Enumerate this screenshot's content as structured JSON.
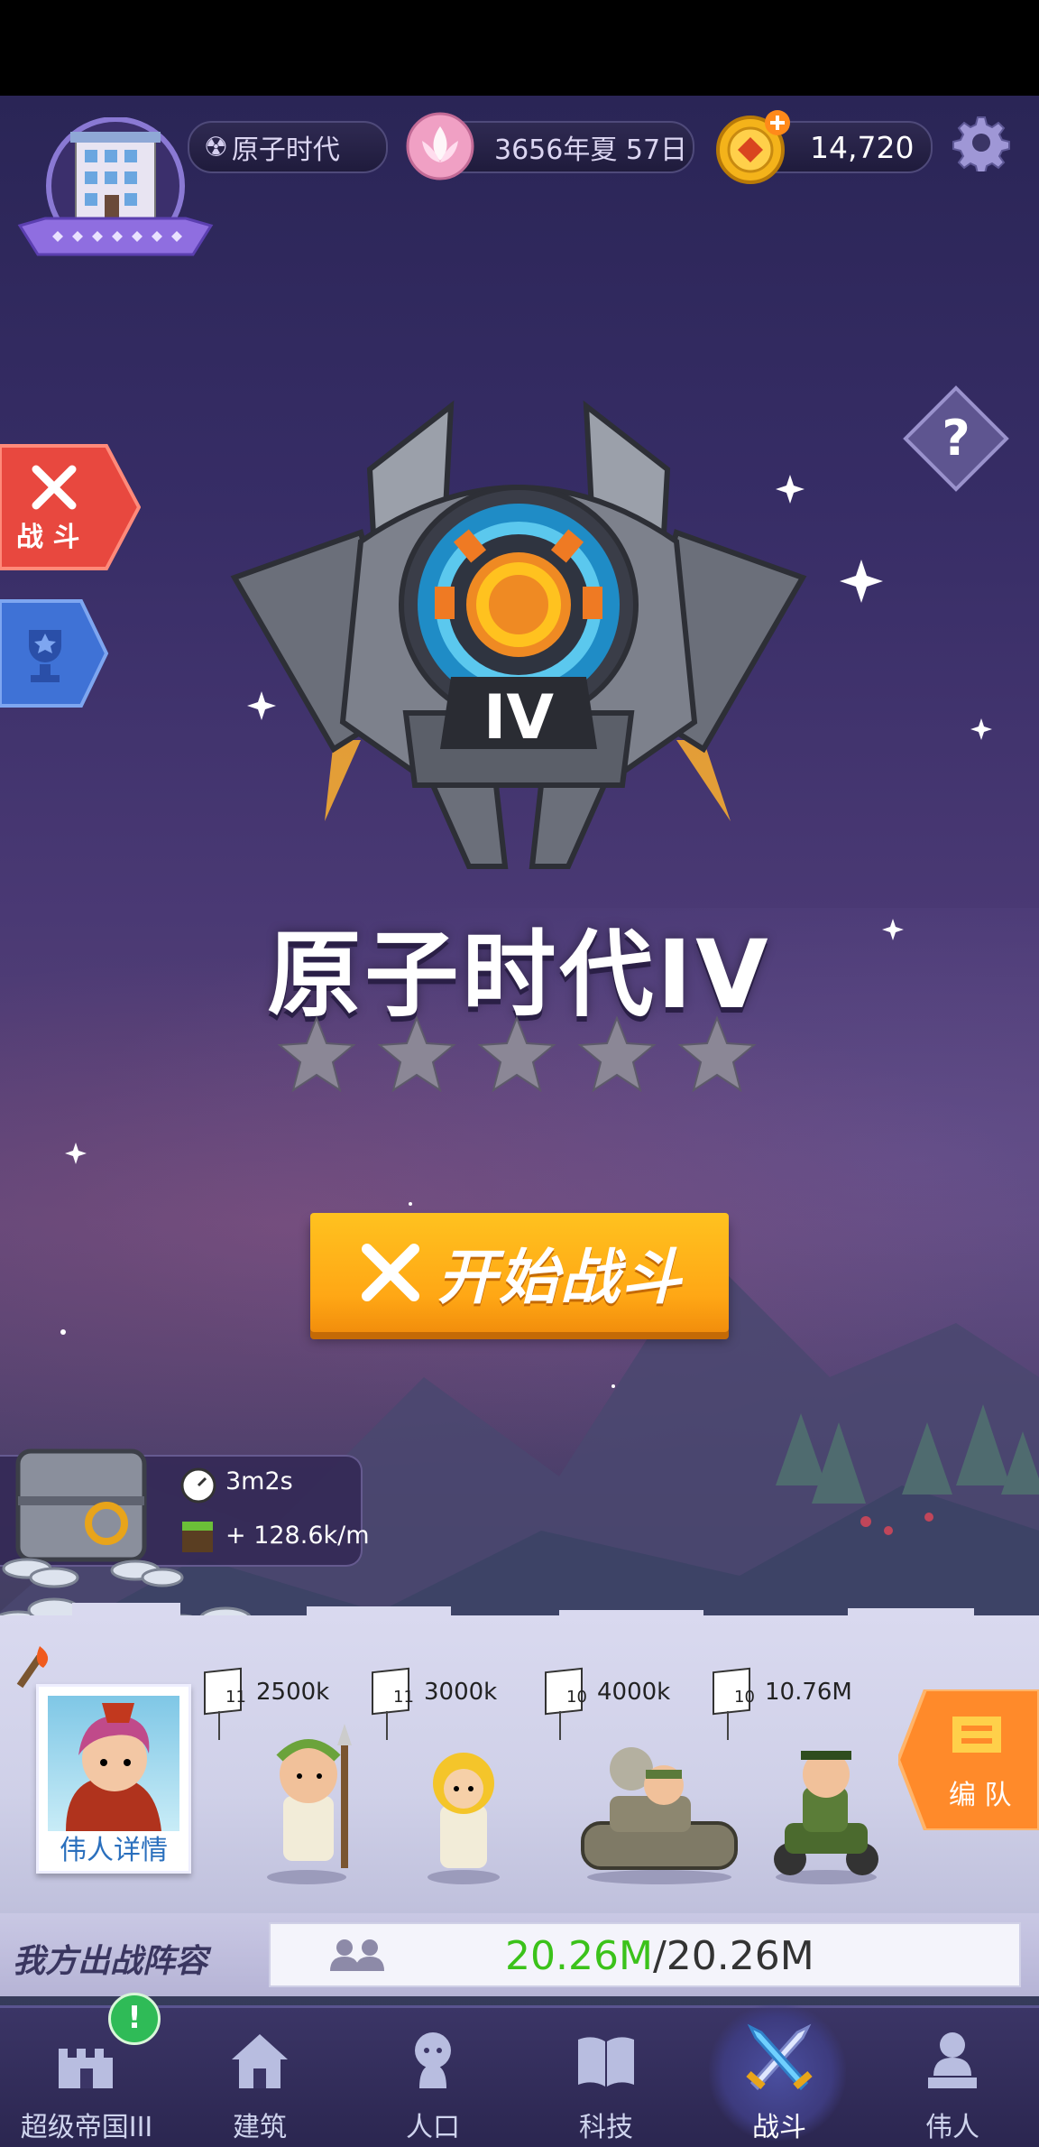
{
  "top_bar": {
    "era_label": "原子时代",
    "date_label": "3656年夏 57日",
    "gold_amount": "14,720"
  },
  "battle_stage": {
    "roman_numeral": "IV",
    "title": "原子时代IV",
    "stars_earned": 0,
    "stars_total": 5,
    "start_button_label": "开始战斗"
  },
  "side_tabs": {
    "battle_label": "战 斗"
  },
  "idle_chest": {
    "timer": "3m2s",
    "rate": "+ 128.6k/m"
  },
  "lineup": {
    "units": [
      {
        "level": "11",
        "power": "2500k"
      },
      {
        "level": "11",
        "power": "3000k"
      },
      {
        "level": "10",
        "power": "4000k"
      },
      {
        "level": "10",
        "power": "10.76M"
      }
    ],
    "hero_details_label": "伟人详情",
    "formation_label": "编 队"
  },
  "power": {
    "label": "我方出战阵容",
    "current": "20.26M",
    "separator_max": "/20.26M"
  },
  "nav": {
    "items": [
      {
        "label": "超级帝国III"
      },
      {
        "label": "建筑"
      },
      {
        "label": "人口"
      },
      {
        "label": "科技"
      },
      {
        "label": "战斗"
      },
      {
        "label": "伟人"
      }
    ],
    "badge_text": "!"
  },
  "colors": {
    "accent_orange": "#ffa715",
    "power_green": "#3bc21a",
    "battle_tab_red": "#e8483f",
    "trophy_tab_blue": "#3f72d6"
  }
}
